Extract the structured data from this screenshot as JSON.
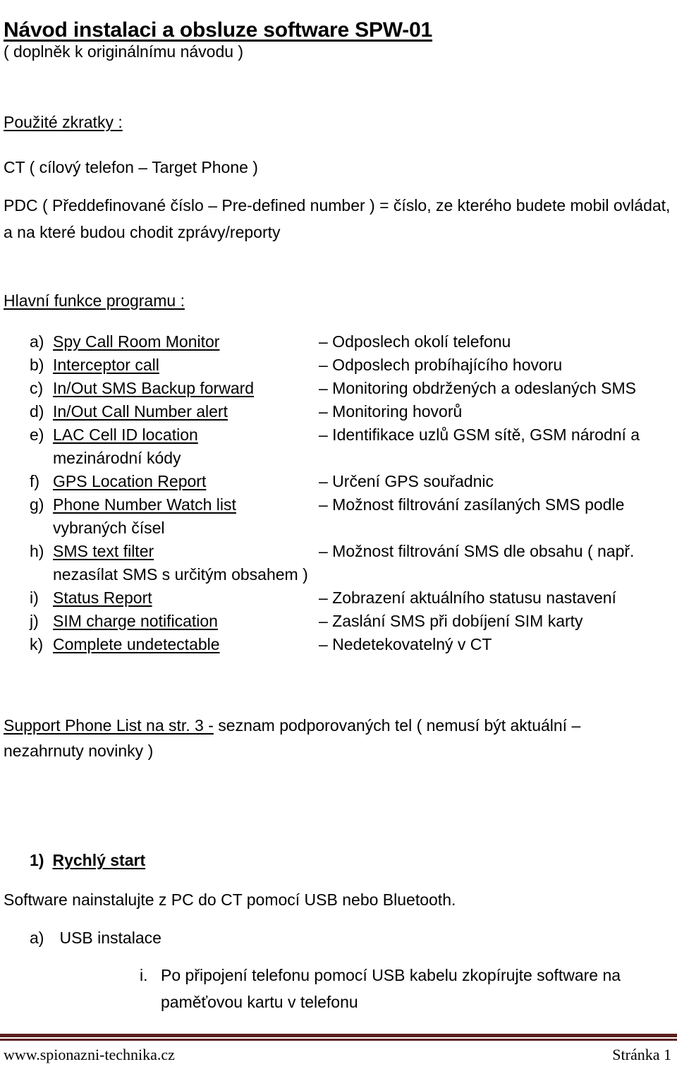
{
  "document": {
    "title": "Návod instalaci a obsluze software SPW-01",
    "subtitle": "( doplněk k originálnímu návodu )"
  },
  "abbreviations": {
    "heading": "Použité zkratky :",
    "ct": "CT ( cílový telefon – Target Phone )",
    "pdc": "PDC ( Předdefinované číslo – Pre-defined number ) = číslo, ze kterého budete mobil ovládat, a na které budou chodit zprávy/reporty"
  },
  "functions": {
    "heading": "Hlavní funkce programu :",
    "items": [
      {
        "marker": "a)",
        "term": "Spy Call Room Monitor",
        "desc": "– Odposlech okolí telefonu",
        "cont": ""
      },
      {
        "marker": "b)",
        "term": "Interceptor call",
        "desc": "– Odposlech probíhajícího hovoru",
        "cont": ""
      },
      {
        "marker": "c)",
        "term": "In/Out SMS Backup forward",
        "desc": "– Monitoring obdržených a odeslaných SMS",
        "cont": ""
      },
      {
        "marker": "d)",
        "term": "In/Out Call Number alert",
        "desc": "– Monitoring hovorů",
        "cont": ""
      },
      {
        "marker": "e)",
        "term": "LAC Cell ID location",
        "desc": "– Identifikace uzlů GSM sítě, GSM národní a",
        "cont": "mezinárodní kódy"
      },
      {
        "marker": "f)",
        "term": "GPS Location Report",
        "desc": "– Určení GPS souřadnic",
        "cont": ""
      },
      {
        "marker": "g)",
        "term": "Phone Number Watch list",
        "desc": "– Možnost filtrování zasílaných SMS podle",
        "cont": "vybraných čísel"
      },
      {
        "marker": "h)",
        "term": "SMS text filter",
        "desc": "– Možnost filtrování SMS dle obsahu ( např.",
        "cont": "nezasílat SMS s určitým obsahem )"
      },
      {
        "marker": "i)",
        "term": "Status Report",
        "desc": "– Zobrazení aktuálního statusu nastavení",
        "cont": ""
      },
      {
        "marker": "j)",
        "term": "SIM charge notification",
        "desc": "– Zaslání SMS při dobíjení SIM karty",
        "cont": ""
      },
      {
        "marker": "k)",
        "term": "Complete undetectable",
        "desc": "– Nedetekovatelný v CT",
        "cont": ""
      }
    ]
  },
  "support": {
    "underlined": "Support Phone List na str. 3  -",
    "rest": " seznam podporovaných tel ( nemusí být aktuální – nezahrnuty novinky )"
  },
  "quickstart": {
    "marker": "1)",
    "heading": "Rychlý start",
    "intro": "Software nainstalujte z PC do CT pomocí USB nebo Bluetooth.",
    "sub_marker": "a)",
    "sub_label": "USB instalace",
    "roman_marker": "i.",
    "roman_text": "Po připojení telefonu pomocí USB kabelu zkopírujte software na paměťovou kartu v telefonu"
  },
  "footer": {
    "site": "www.spionazni-technika.cz",
    "page": "Stránka 1",
    "rule_color": "#5C2020"
  }
}
